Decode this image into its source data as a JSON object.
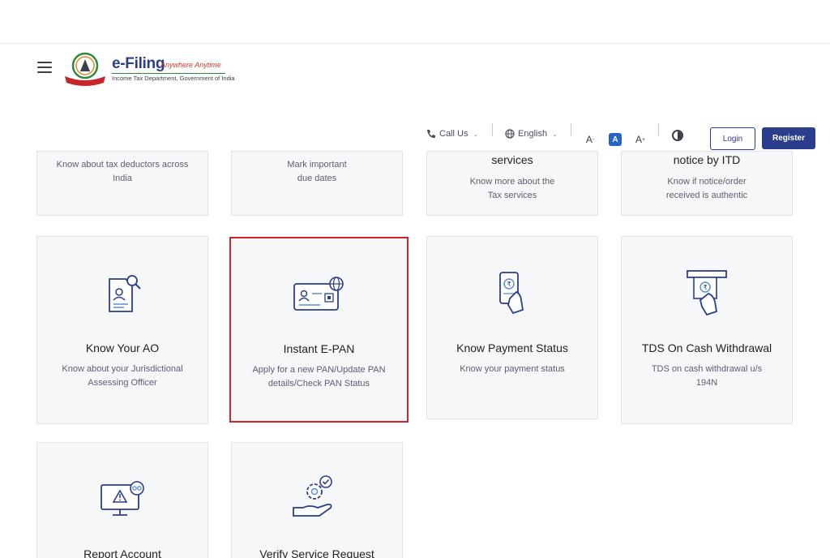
{
  "header": {
    "logo_title": "e-Filing",
    "logo_tagline": "Anywhere Anytime",
    "logo_subtitle": "Income Tax Department, Government of India"
  },
  "utility": {
    "call_us": "Call Us",
    "language": "English",
    "font_decrease": "A",
    "font_default": "A",
    "font_increase": "A",
    "login": "Login",
    "register": "Register"
  },
  "cards_top": [
    {
      "title": "",
      "desc": "Know about tax deductors across India"
    },
    {
      "title": "",
      "desc": "Mark important due dates"
    },
    {
      "title": "services",
      "desc": "Know more about the Tax services"
    },
    {
      "title": "notice by ITD",
      "desc": "Know if notice/order received is authentic"
    }
  ],
  "cards_mid": [
    {
      "title": "Know Your AO",
      "desc": "Know about your Jurisdictional Assessing Officer",
      "icon": "document-search-icon"
    },
    {
      "title": "Instant E-PAN",
      "desc": "Apply for a new PAN/Update PAN details/Check PAN Status",
      "icon": "id-card-globe-icon"
    },
    {
      "title": "Know Payment Status",
      "desc": "Know your payment status",
      "icon": "mobile-payment-icon"
    },
    {
      "title": "TDS On Cash Withdrawal",
      "desc": "TDS on cash withdrawal u/s 194N",
      "icon": "atm-cash-icon"
    }
  ],
  "cards_bottom": [
    {
      "title": "Report Account",
      "icon": "monitor-warning-icon"
    },
    {
      "title": "Verify Service Request",
      "icon": "hand-gear-check-icon"
    }
  ],
  "colors": {
    "brand_blue": "#2a3e8c",
    "highlight_red": "#c8262c",
    "active_font": "#2563c9"
  }
}
